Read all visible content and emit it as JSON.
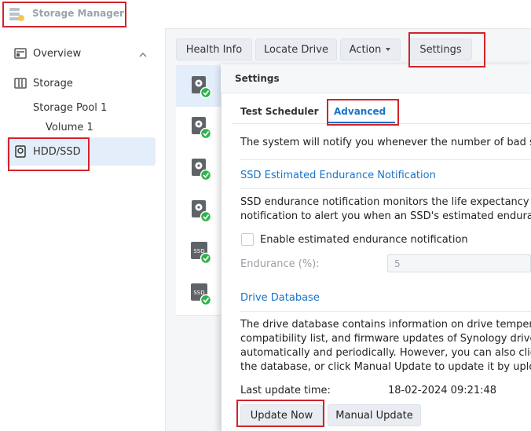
{
  "app": {
    "title": "Storage Manager"
  },
  "sidebar": {
    "overview": "Overview",
    "storage": "Storage",
    "storage_pool": "Storage Pool 1",
    "volume": "Volume 1",
    "hdd_ssd": "HDD/SSD"
  },
  "toolbar": {
    "health_info": "Health Info",
    "locate_drive": "Locate Drive",
    "action": "Action",
    "settings": "Settings"
  },
  "drives": [
    {
      "type": "hdd",
      "label": ""
    },
    {
      "type": "hdd",
      "label": ""
    },
    {
      "type": "hdd",
      "label": ""
    },
    {
      "type": "hdd",
      "label": ""
    },
    {
      "type": "ssd",
      "label": "SSD"
    },
    {
      "type": "ssd",
      "label": "SSD"
    }
  ],
  "dialog": {
    "title": "Settings",
    "tabs": {
      "test_scheduler": "Test Scheduler",
      "advanced": "Advanced"
    },
    "bad_sector_text": "The system will notify you whenever the number of bad se",
    "ssd_section_title": "SSD Estimated Endurance Notification",
    "ssd_desc_line1": "SSD endurance notification monitors the life expectancy of",
    "ssd_desc_line2": "notification to alert you when an SSD's estimated enduranc",
    "enable_label": "Enable estimated endurance notification",
    "endurance_label": "Endurance (%):",
    "endurance_value": "5",
    "drive_db_title": "Drive Database",
    "db_line1": "The drive database contains information on drive temperat",
    "db_line2": "compatibility list, and firmware updates of Synology drives.",
    "db_line3": "automatically and periodically. However, you can also click U",
    "db_line4": "the database, or click Manual Update to update it by uploa",
    "last_update_label": "Last update time:",
    "last_update_value": "18-02-2024 09:21:48",
    "update_now": "Update Now",
    "manual_update": "Manual Update"
  },
  "colors": {
    "accent": "#1a73c8",
    "highlight": "#d3232a",
    "ok_green": "#2db34a"
  }
}
